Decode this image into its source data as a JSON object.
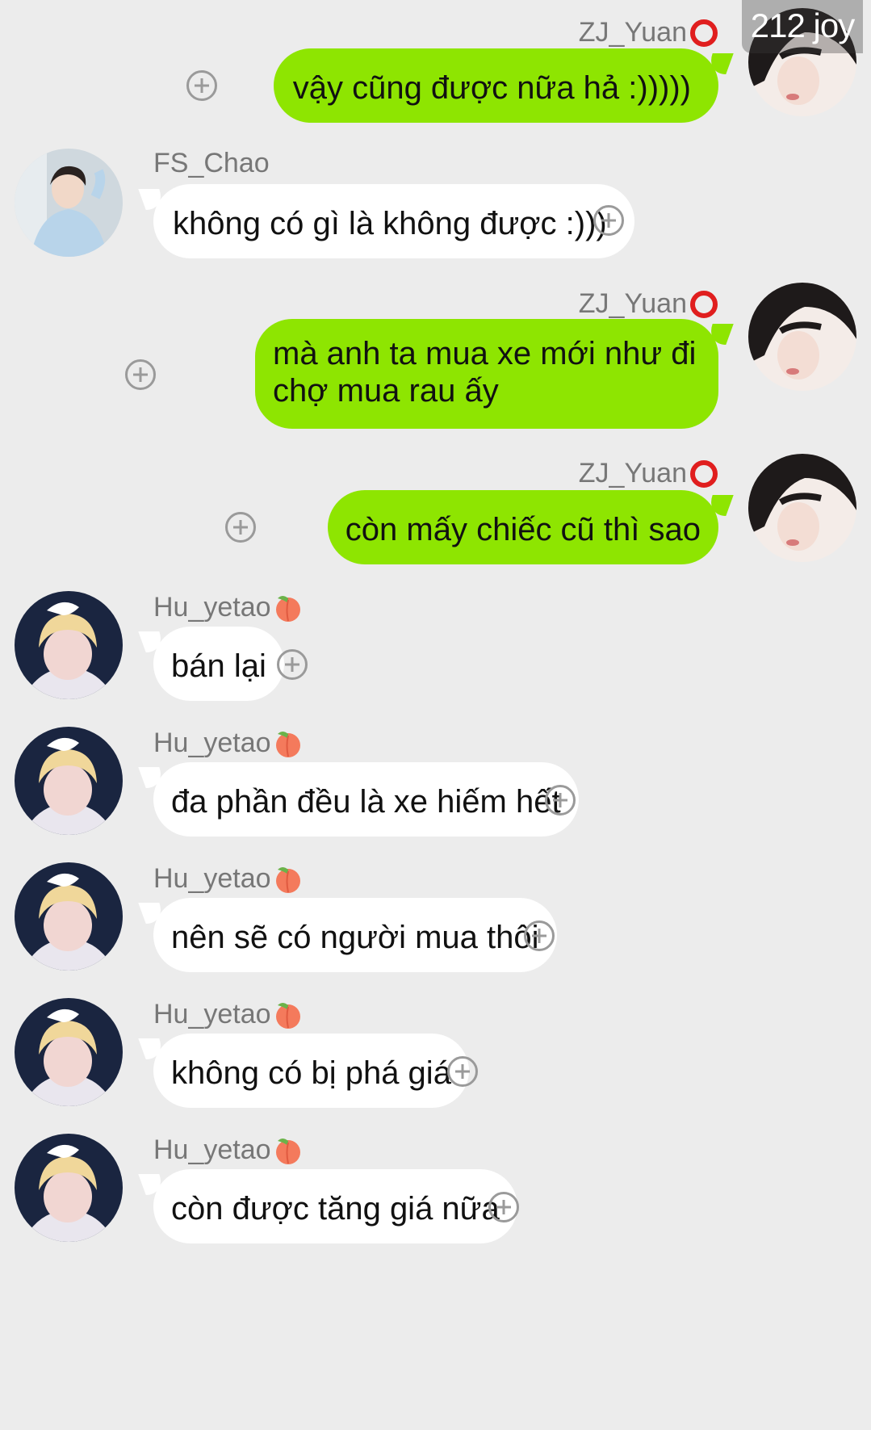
{
  "watermark": "212 joy",
  "messages": [
    {
      "side": "right",
      "sender": "ZJ_Yuan",
      "sender_emoji": "red-circle",
      "text": "vậy cũng được nữa hả :)))))",
      "avatar": "zj-yuan"
    },
    {
      "side": "left",
      "sender": "FS_Chao",
      "sender_emoji": "",
      "text": "không có gì là không được :)))",
      "avatar": "fs-chao"
    },
    {
      "side": "right",
      "sender": "ZJ_Yuan",
      "sender_emoji": "red-circle",
      "text": "mà anh ta mua xe mới như đi chợ mua rau ấy",
      "avatar": "zj-yuan"
    },
    {
      "side": "right",
      "sender": "ZJ_Yuan",
      "sender_emoji": "red-circle",
      "text": "còn mấy chiếc cũ thì sao",
      "avatar": "zj-yuan"
    },
    {
      "side": "left",
      "sender": "Hu_yetao",
      "sender_emoji": "peach",
      "text": "bán lại",
      "avatar": "hu-yetao"
    },
    {
      "side": "left",
      "sender": "Hu_yetao",
      "sender_emoji": "peach",
      "text": "đa phần đều là xe hiếm hết",
      "avatar": "hu-yetao"
    },
    {
      "side": "left",
      "sender": "Hu_yetao",
      "sender_emoji": "peach",
      "text": "nên sẽ có người mua thôi",
      "avatar": "hu-yetao"
    },
    {
      "side": "left",
      "sender": "Hu_yetao",
      "sender_emoji": "peach",
      "text": "không có bị phá giá",
      "avatar": "hu-yetao"
    },
    {
      "side": "left",
      "sender": "Hu_yetao",
      "sender_emoji": "peach",
      "text": "còn được tăng giá nữa",
      "avatar": "hu-yetao"
    }
  ],
  "colors": {
    "background": "#ececec",
    "outgoing_bubble": "#8ee501",
    "incoming_bubble": "#ffffff",
    "sender_name": "#777777",
    "plus_icon": "#9a9a9a"
  },
  "icons": {
    "add": "plus-circle-icon",
    "red_circle": "red-circle-emoji",
    "peach": "peach-emoji"
  }
}
